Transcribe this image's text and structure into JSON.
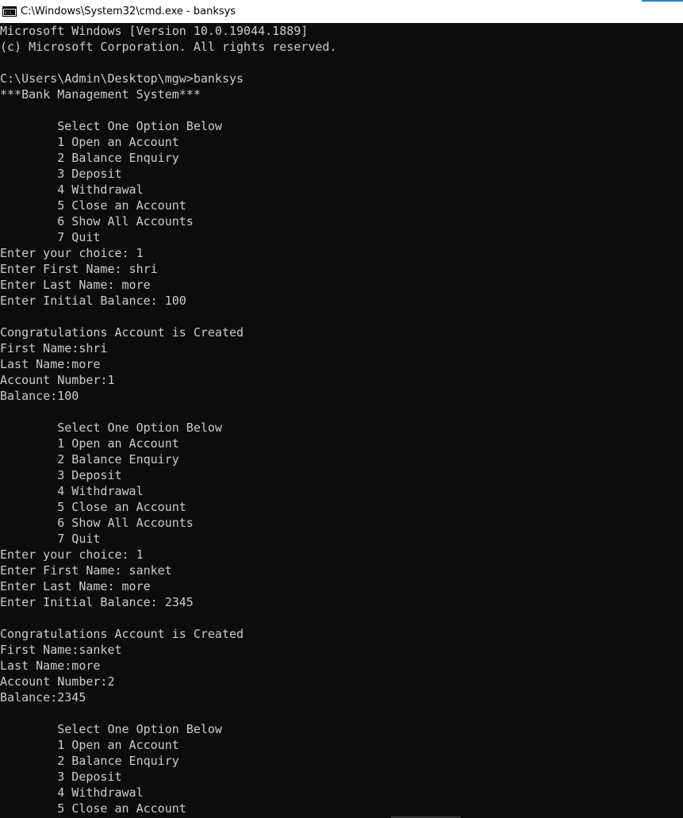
{
  "window": {
    "title": "C:\\Windows\\System32\\cmd.exe - banksys",
    "icon": "cmd-icon"
  },
  "console": {
    "lines": [
      "Microsoft Windows [Version 10.0.19044.1889]",
      "(c) Microsoft Corporation. All rights reserved.",
      "",
      "C:\\Users\\Admin\\Desktop\\mgw>banksys",
      "***Bank Management System***",
      "",
      "        Select One Option Below",
      "        1 Open an Account",
      "        2 Balance Enquiry",
      "        3 Deposit",
      "        4 Withdrawal",
      "        5 Close an Account",
      "        6 Show All Accounts",
      "        7 Quit",
      "Enter your choice: 1",
      "Enter First Name: shri",
      "Enter Last Name: more",
      "Enter Initial Balance: 100",
      "",
      "Congratulations Account is Created",
      "First Name:shri",
      "Last Name:more",
      "Account Number:1",
      "Balance:100",
      "",
      "        Select One Option Below",
      "        1 Open an Account",
      "        2 Balance Enquiry",
      "        3 Deposit",
      "        4 Withdrawal",
      "        5 Close an Account",
      "        6 Show All Accounts",
      "        7 Quit",
      "Enter your choice: 1",
      "Enter First Name: sanket",
      "Enter Last Name: more",
      "Enter Initial Balance: 2345",
      "",
      "Congratulations Account is Created",
      "First Name:sanket",
      "Last Name:more",
      "Account Number:2",
      "Balance:2345",
      "",
      "        Select One Option Below",
      "        1 Open an Account",
      "        2 Balance Enquiry",
      "        3 Deposit",
      "        4 Withdrawal",
      "        5 Close an Account"
    ]
  },
  "colors": {
    "console_background": "#0c0c0c",
    "console_text": "#cccccc",
    "titlebar_background": "#ffffff",
    "accent": "#3478c6"
  }
}
